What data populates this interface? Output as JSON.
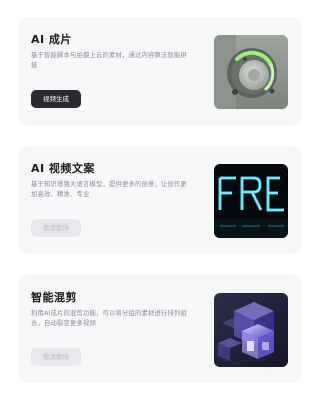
{
  "cards": [
    {
      "title": "AI 成片",
      "description": "基于智能脚本与拍摄上云的素材，通过内容算法智能拼接",
      "button_label": "视频生成",
      "button_state": "active",
      "thumbnail_icon": "ring-knob-render"
    },
    {
      "title": "AI 视频文案",
      "description": "基于知识增强大语言模型，提供更多的创意，让创作更加高效、精准、专业",
      "button_label": "敬请期待",
      "button_state": "disabled",
      "thumbnail_icon": "neon-text-render"
    },
    {
      "title": "智能混剪",
      "description": "利用AI成片的混剪功能，可以将分组的素材进行排列组合，自动裂变更多视频",
      "button_label": "敬请期待",
      "button_state": "disabled",
      "thumbnail_icon": "glass-cubes-render"
    }
  ],
  "colors": {
    "card_bg": "#f6f7f9",
    "active_button": "#2a2b2e",
    "disabled_button": "#e7e8eb",
    "title": "#1b1b1b",
    "description": "#8a8d93"
  }
}
